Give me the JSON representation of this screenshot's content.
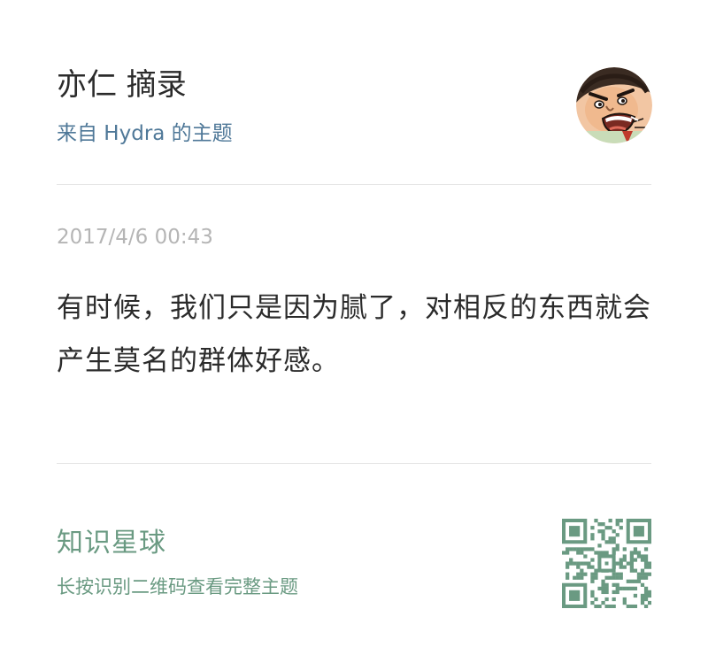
{
  "header": {
    "author": "亦仁 摘录",
    "source": "来自 Hydra 的主题"
  },
  "post": {
    "timestamp": "2017/4/6 00:43",
    "content": "有时候，我们只是因为腻了，对相反的东西就会产生莫名的群体好感。"
  },
  "footer": {
    "brand": "知识星球",
    "hint": "长按识别二维码查看完整主题"
  },
  "colors": {
    "accent_blue": "#4f7898",
    "accent_green": "#6a9a82",
    "text_dark": "#2b2b2b",
    "text_muted": "#b5b5b5",
    "divider": "#e4e4e4"
  },
  "icons": {
    "avatar": "cartoon-face-avatar",
    "qr": "qr-code-icon"
  }
}
